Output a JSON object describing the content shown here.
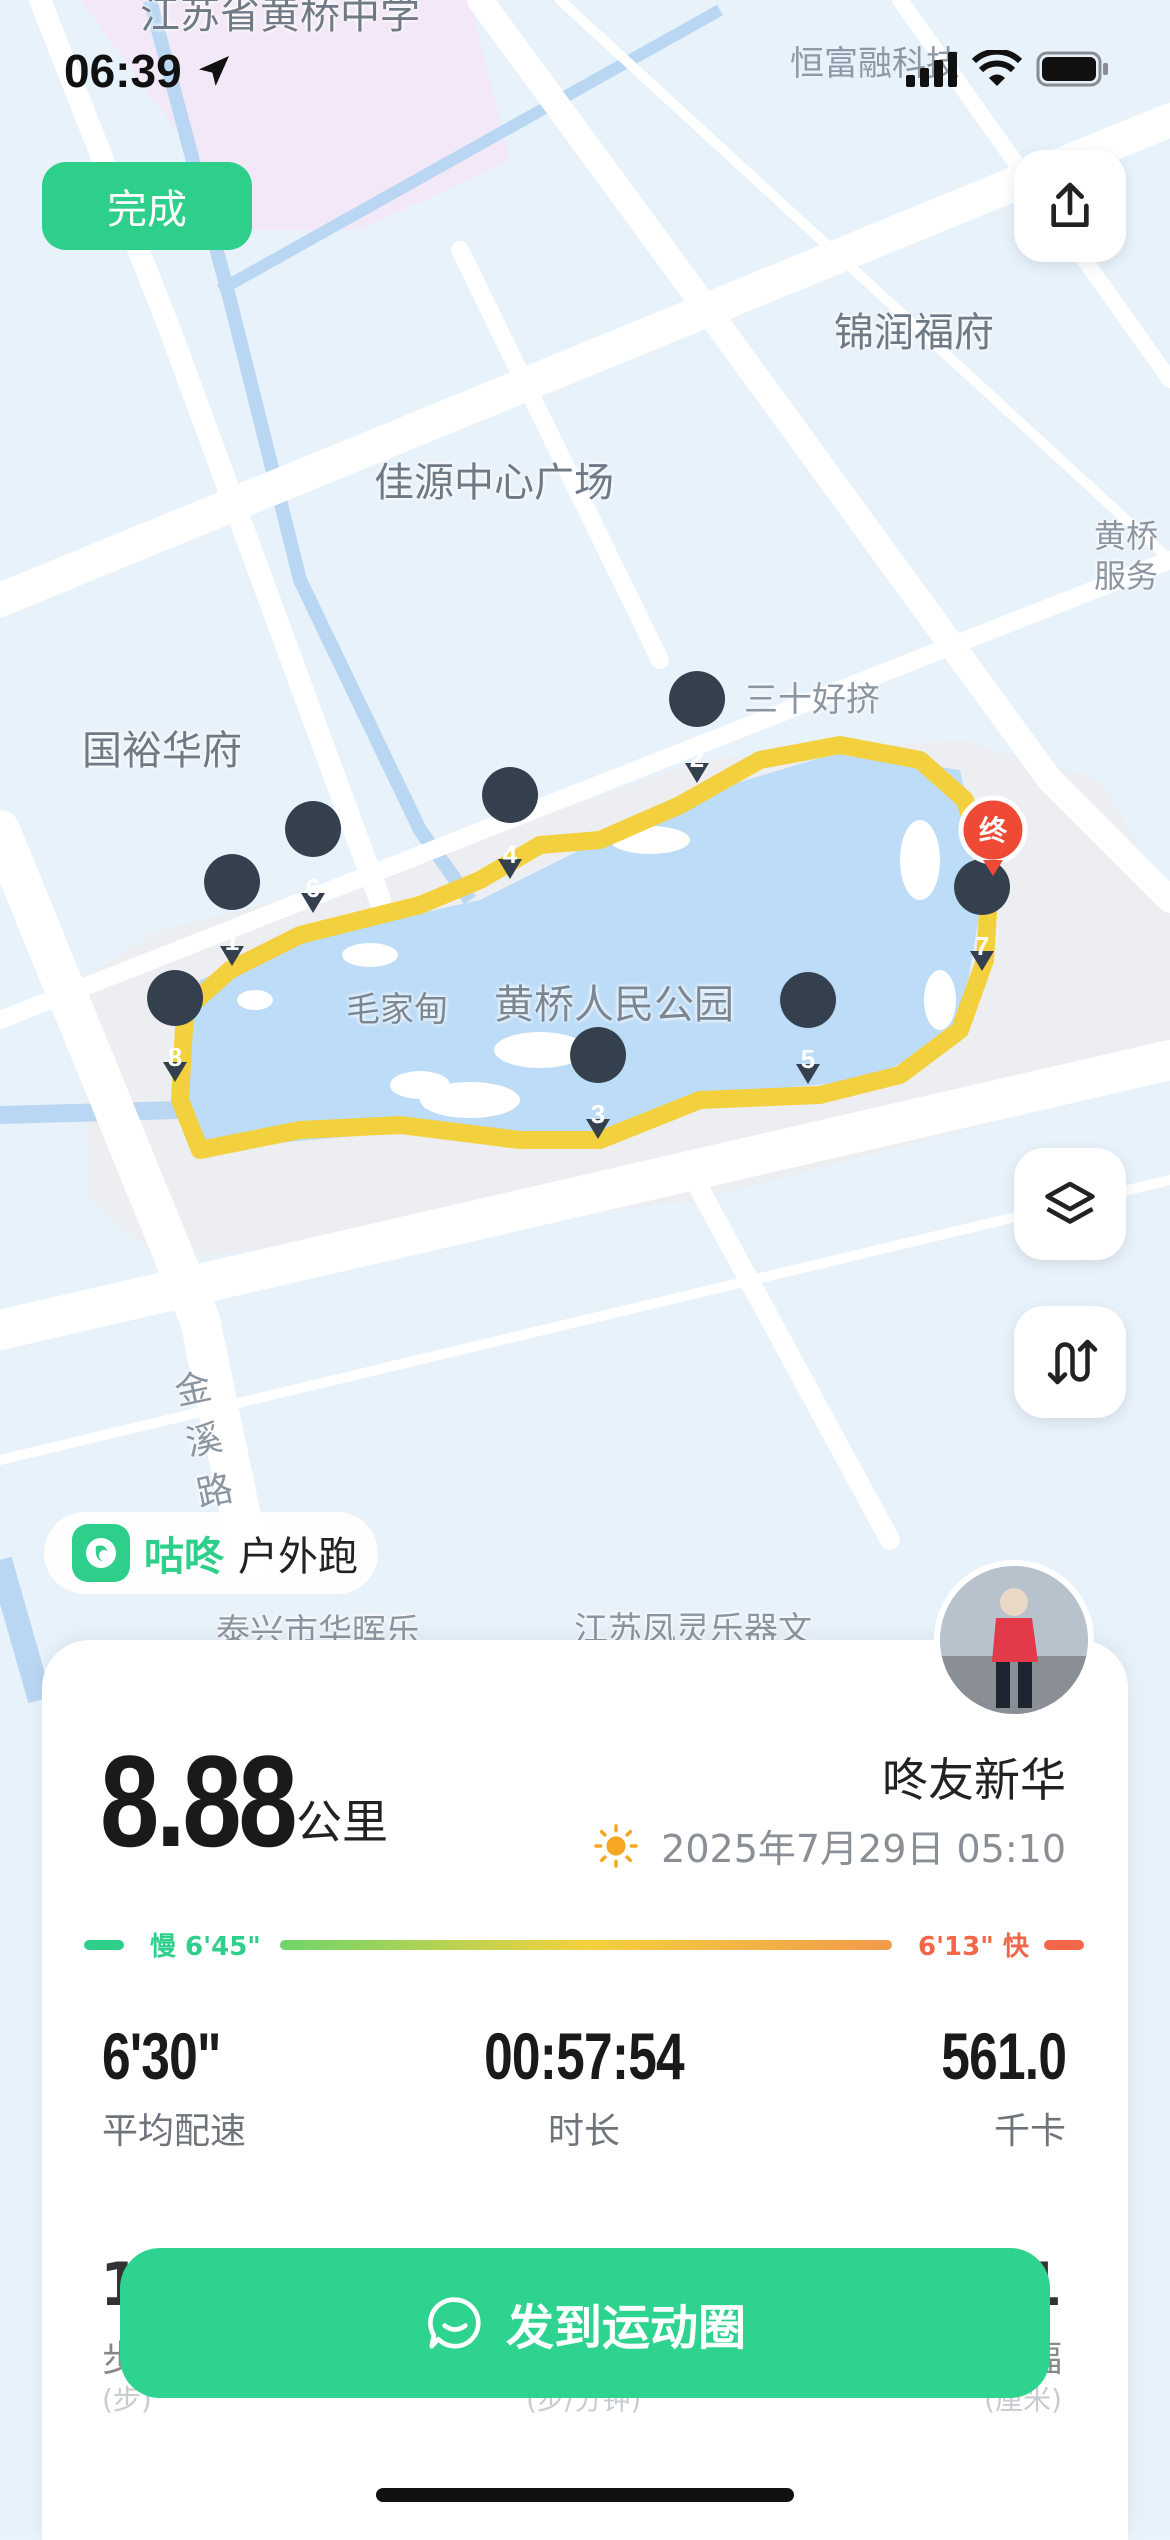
{
  "status_bar": {
    "time": "06:39",
    "carrier": "恒富融科技"
  },
  "top": {
    "done_label": "完成"
  },
  "map": {
    "labels": {
      "school": "江苏省黄桥中学",
      "jinrun": "锦润福府",
      "jiayuan": "佳源中心广场",
      "huangqiao_service": "黄桥服务",
      "guoyu": "国裕华府",
      "sanshi": "三十好挤",
      "maojia": "毛家甸",
      "park": "黄桥人民公园",
      "jinxi_road": "金溪路",
      "taixing": "泰兴市华晖乐",
      "fengling": "江苏凤灵乐器文"
    },
    "markers": [
      "1",
      "2",
      "3",
      "4",
      "5",
      "6",
      "7",
      "8"
    ],
    "end_marker": "终"
  },
  "brand": {
    "name": "咕咚",
    "activity": "户外跑"
  },
  "summary": {
    "distance": "8.88",
    "distance_unit": "公里",
    "user": "咚友新华",
    "datetime": "2025年7月29日 05:10",
    "slow_label": "慢 6'45\"",
    "fast_label": "6'13\" 快"
  },
  "stats": [
    {
      "value": "6'30\"",
      "label": "平均配速"
    },
    {
      "value": "00:57:54",
      "label": "时长"
    },
    {
      "value": "561.0",
      "label": "千卡"
    }
  ],
  "peek": {
    "left_val": "1",
    "left_label": "步",
    "left_unit": "(步)",
    "mid_unit": "(步/分钟)",
    "right_val": "1",
    "right_label": "幅",
    "right_unit": "(厘米)"
  },
  "share_button": "发到运动圈",
  "colors": {
    "accent": "#2dcf8a",
    "route": "#f3d13e",
    "water": "#bcdcf7",
    "pace_slow": "#2dcf8a",
    "pace_fast": "#f2674a"
  }
}
